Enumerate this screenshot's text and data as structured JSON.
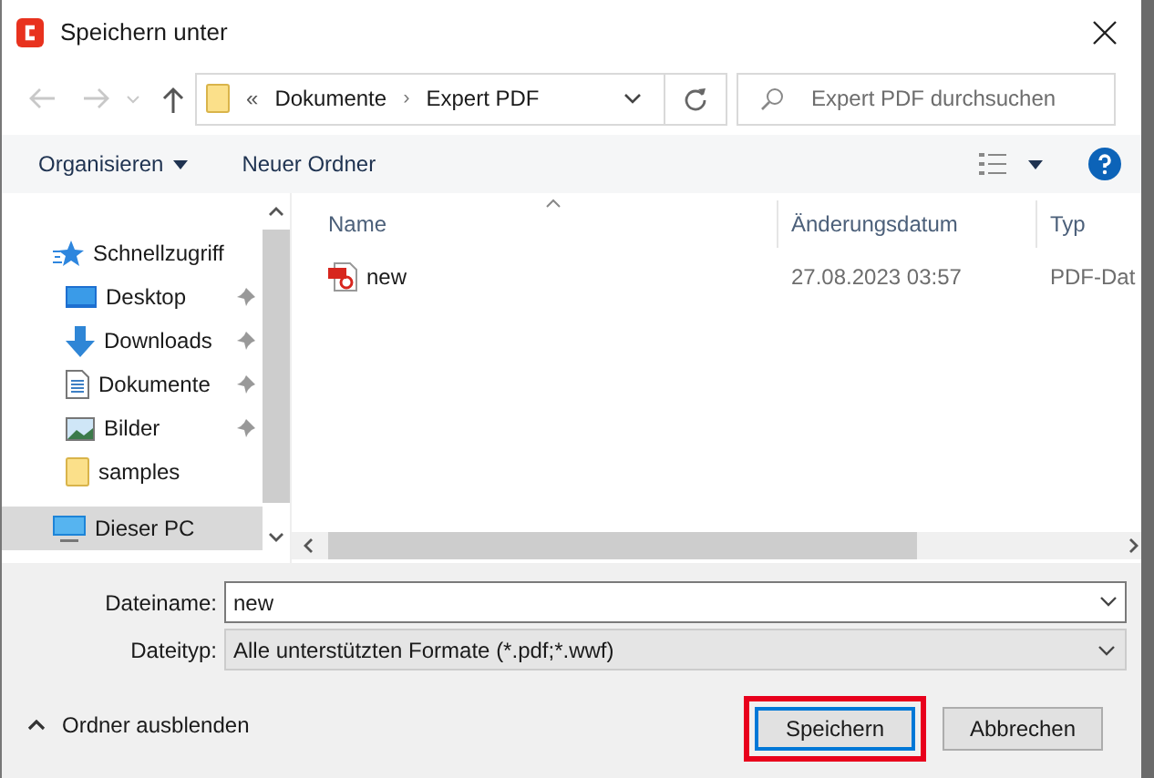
{
  "window": {
    "title": "Speichern unter"
  },
  "address_bar": {
    "prefix": "«",
    "separator": "›",
    "segments": [
      "Dokumente",
      "Expert PDF"
    ]
  },
  "search": {
    "placeholder": "Expert PDF durchsuchen"
  },
  "toolbar": {
    "organize": "Organisieren",
    "new_folder": "Neuer Ordner"
  },
  "navigation": [
    {
      "label": "Schnellzugriff",
      "kind": "quick",
      "pinned": false,
      "selected": false
    },
    {
      "label": "Desktop",
      "kind": "desktop",
      "pinned": true,
      "selected": false
    },
    {
      "label": "Downloads",
      "kind": "downloads",
      "pinned": true,
      "selected": false
    },
    {
      "label": "Dokumente",
      "kind": "documents",
      "pinned": true,
      "selected": false
    },
    {
      "label": "Bilder",
      "kind": "pictures",
      "pinned": true,
      "selected": false
    },
    {
      "label": "samples",
      "kind": "folder",
      "pinned": false,
      "selected": false
    },
    {
      "label": "Dieser PC",
      "kind": "pc",
      "pinned": false,
      "selected": true
    }
  ],
  "columns": [
    "Name",
    "Änderungsdatum",
    "Typ"
  ],
  "files": [
    {
      "name": "new",
      "modified": "27.08.2023 03:57",
      "type": "PDF-Dat"
    }
  ],
  "filename": {
    "label": "Dateiname:",
    "value": "new"
  },
  "filetype": {
    "label": "Dateityp:",
    "value": "Alle unterstützten Formate (*.pdf;*.wwf)"
  },
  "hide_folders": "Ordner ausblenden",
  "buttons": [
    {
      "label": "Speichern",
      "default": true,
      "highlighted": true
    },
    {
      "label": "Abbrechen",
      "default": false,
      "highlighted": false
    }
  ]
}
